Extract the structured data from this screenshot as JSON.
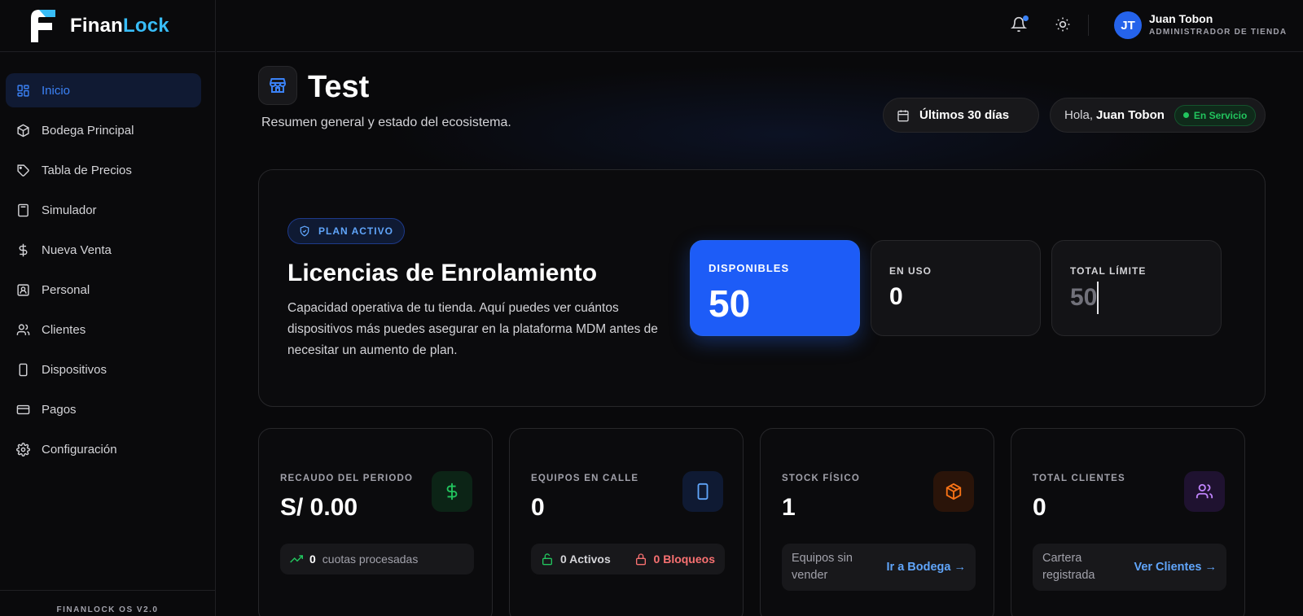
{
  "brand": {
    "name_main": "Finan",
    "name_accent": "Lock"
  },
  "sidebar": {
    "items": [
      {
        "label": "Inicio",
        "icon": "grid-icon"
      },
      {
        "label": "Bodega Principal",
        "icon": "package-icon"
      },
      {
        "label": "Tabla de Precios",
        "icon": "tag-icon"
      },
      {
        "label": "Simulador",
        "icon": "calculator-icon"
      },
      {
        "label": "Nueva Venta",
        "icon": "dollar-icon"
      },
      {
        "label": "Personal",
        "icon": "id-card-icon"
      },
      {
        "label": "Clientes",
        "icon": "users-icon"
      },
      {
        "label": "Dispositivos",
        "icon": "smartphone-icon"
      },
      {
        "label": "Pagos",
        "icon": "credit-card-icon"
      },
      {
        "label": "Configuración",
        "icon": "gear-icon"
      }
    ],
    "footer": "FINANLOCK OS V2.0"
  },
  "topbar": {
    "user_initials": "JT",
    "user_name": "Juan Tobon",
    "user_role": "ADMINISTRADOR DE TIENDA"
  },
  "header": {
    "title": "Test",
    "subtitle": "Resumen general y estado del ecosistema.",
    "date_range": "Últimos 30 días",
    "greeting": "Hola,",
    "greeting_name": "Juan Tobon",
    "status": "En Servicio"
  },
  "license": {
    "badge": "PLAN ACTIVO",
    "title": "Licencias de Enrolamiento",
    "description": "Capacidad operativa de tu tienda. Aquí puedes ver cuántos dispositivos más puedes asegurar en la plataforma MDM antes de necesitar un aumento de plan.",
    "stats": [
      {
        "label": "DISPONIBLES",
        "value": "50"
      },
      {
        "label": "EN USO",
        "value": "0"
      },
      {
        "label": "TOTAL LÍMITE",
        "value": "50"
      }
    ]
  },
  "metrics": {
    "recaudo": {
      "label": "RECAUDO DEL PERIODO",
      "value": "S/ 0.00",
      "foot_count": "0",
      "foot_text": "cuotas procesadas"
    },
    "equipos": {
      "label": "EQUIPOS EN CALLE",
      "value": "0",
      "activos": "0 Activos",
      "bloqueos": "0 Bloqueos"
    },
    "stock": {
      "label": "STOCK FÍSICO",
      "value": "1",
      "foot_text": "Equipos sin vender",
      "link": "Ir a Bodega →"
    },
    "clientes": {
      "label": "TOTAL CLIENTES",
      "value": "0",
      "foot_text": "Cartera registrada",
      "link": "Ver Clientes →"
    }
  },
  "colors": {
    "accent": "#2563eb",
    "brand_accent": "#38bdf8",
    "success": "#22c55e",
    "danger": "#f87171",
    "stock_orange": "#f97316",
    "clients_purple": "#c084fc"
  }
}
